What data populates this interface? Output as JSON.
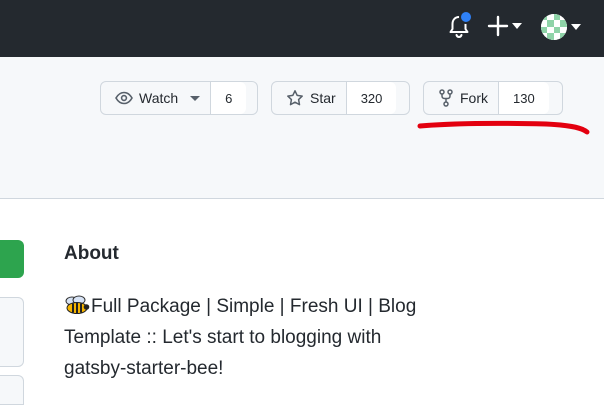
{
  "header": {
    "icons": [
      "bell-icon",
      "plus-icon",
      "avatar"
    ],
    "notification_color": "#2f81f7"
  },
  "repo_actions": {
    "watch": {
      "label": "Watch",
      "count": "6"
    },
    "star": {
      "label": "Star",
      "count": "320"
    },
    "fork": {
      "label": "Fork",
      "count": "130"
    }
  },
  "annotation": {
    "color": "#e3000f"
  },
  "about": {
    "title": "About",
    "description": "Full Package | Simple | Fresh UI | Blog Template :: Let's start to blogging with gatsby-starter-bee!",
    "emoji": "bee-icon"
  },
  "colors": {
    "topbar": "#24292f",
    "green": "#2da44e",
    "border": "#d0d7de",
    "subtle_bg": "#f6f8fa"
  }
}
